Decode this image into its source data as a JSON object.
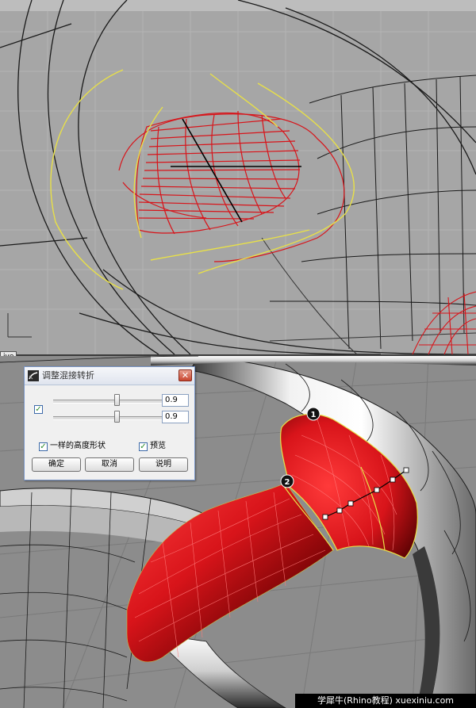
{
  "viewport_bottom": {
    "label": "ive"
  },
  "dialog": {
    "title": "调整混接转折",
    "close_symbol": "✕",
    "slider1": {
      "value": "0.9",
      "fraction": 0.9
    },
    "slider2": {
      "value": "0.9",
      "fraction": 0.9
    },
    "same_height": {
      "label": "一样的高度形状",
      "checked": true
    },
    "preview": {
      "label": "预览",
      "checked": true
    },
    "link_checked": true,
    "buttons": {
      "ok": "确定",
      "cancel": "取消",
      "help": "说明"
    }
  },
  "markers": {
    "m1": "1",
    "m2": "2"
  },
  "watermark": "学犀牛(Rhino教程)  xuexiniu.com",
  "colors": {
    "surface_red": "#d8141a",
    "curve_yellow": "#e8e048",
    "grid_line": "#1a1a1a"
  },
  "icons": {
    "check": "✓"
  }
}
